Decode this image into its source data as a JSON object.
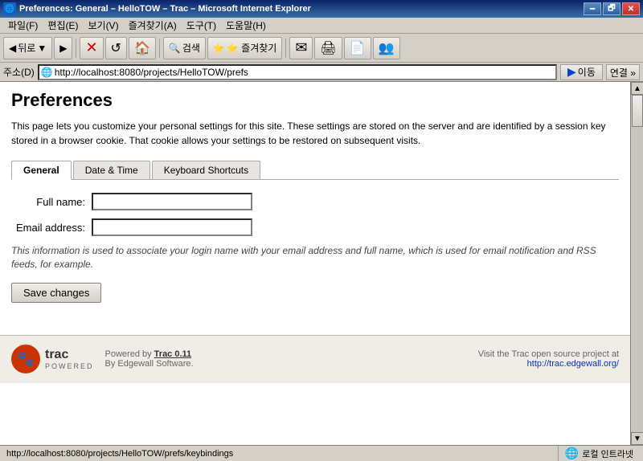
{
  "titlebar": {
    "title": "Preferences: General – HelloTOW – Trac – Microsoft Internet Explorer",
    "icon": "🌐",
    "minimize": "🗕",
    "restore": "🗗",
    "close": "✕"
  },
  "menubar": {
    "items": [
      "파일(F)",
      "편집(E)",
      "보기(V)",
      "즐겨찾기(A)",
      "도구(T)",
      "도움말(H)"
    ]
  },
  "toolbar": {
    "back": "뒤로",
    "forward": "▶",
    "stop": "✕",
    "refresh": "↺",
    "home": "🏠",
    "search": "검색",
    "favorites": "⭐ 즐겨찾기",
    "mail": "✉",
    "print": "🖨",
    "edit": "📄",
    "discuss": "👥"
  },
  "addressbar": {
    "label": "주소(D)",
    "url": "http://localhost:8080/projects/HelloTOW/prefs",
    "go_label": "이동",
    "links_label": "연결",
    "favicon": "🌐"
  },
  "page": {
    "title": "Preferences",
    "description": "This page lets you customize your personal settings for this site. These settings are stored on the server and are identified by a session key stored in a browser cookie. That cookie allows your settings to be restored on subsequent visits.",
    "tabs": [
      {
        "id": "general",
        "label": "General",
        "active": true
      },
      {
        "id": "datetime",
        "label": "Date & Time",
        "active": false
      },
      {
        "id": "keyboard",
        "label": "Keyboard Shortcuts",
        "active": false
      }
    ],
    "form": {
      "fullname_label": "Full name:",
      "fullname_placeholder": "",
      "email_label": "Email address:",
      "email_placeholder": "",
      "note": "This information is used to associate your login name with your email address and full name, which is used for email notification and RSS feeds, for example.",
      "save_button": "Save changes"
    }
  },
  "footer": {
    "paw": "🐾",
    "trac_text": "trac",
    "powered_by": "Powered by",
    "trac_version": "Trac 0.11",
    "by_edgewall": "By Edgewall Software.",
    "visit_text": "Visit the Trac open source project at",
    "trac_url": "http://trac.edgewall.org/"
  },
  "statusbar": {
    "url": "http://localhost:8080/projects/HelloTOW/prefs/keybindings",
    "zone_icon": "🌐",
    "zone_label": "로컬 인트라넷"
  }
}
